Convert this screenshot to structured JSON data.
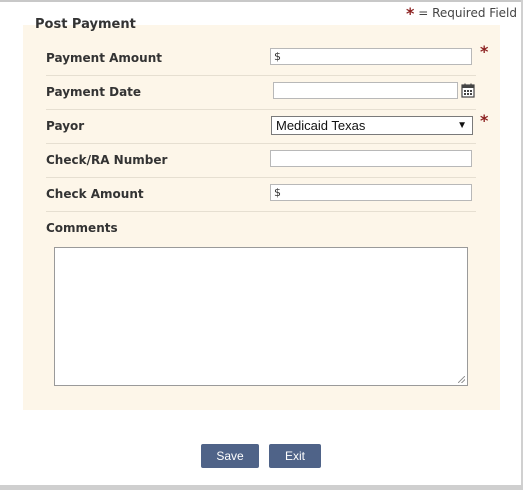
{
  "required_note": {
    "star": "*",
    "text": "= Required Field"
  },
  "form": {
    "title": "Post Payment",
    "fields": {
      "payment_amount": {
        "label": "Payment Amount",
        "value": "$",
        "required": true
      },
      "payment_date": {
        "label": "Payment Date",
        "value": "",
        "icon": "calendar-icon"
      },
      "payor": {
        "label": "Payor",
        "value": "Medicaid Texas",
        "required": true,
        "arrow": "▼"
      },
      "check_ra_number": {
        "label": "Check/RA Number",
        "value": ""
      },
      "check_amount": {
        "label": "Check Amount",
        "value": "$"
      },
      "comments": {
        "label": "Comments",
        "value": ""
      }
    },
    "row_star": "*"
  },
  "buttons": {
    "save": "Save",
    "exit": "Exit"
  },
  "colors": {
    "panel_bg": "#fdf6e9",
    "button_bg": "#4f6388",
    "required_star": "#8b1f1f"
  }
}
